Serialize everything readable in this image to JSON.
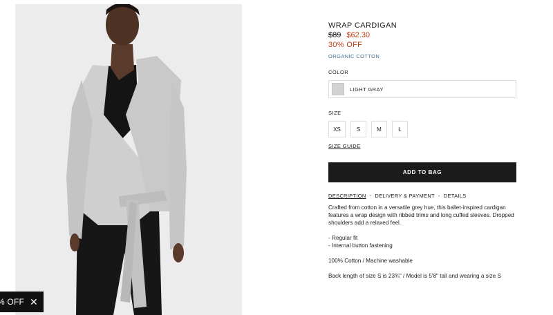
{
  "product": {
    "title": "WRAP CARDIGAN",
    "old_price": "$89",
    "new_price": "$62.30",
    "discount": "30% OFF",
    "material": "ORGANIC COTTON"
  },
  "color": {
    "label": "COLOR",
    "selected": "LIGHT GRAY",
    "swatch": "#d3d3d3"
  },
  "size": {
    "label": "SIZE",
    "options": [
      "XS",
      "S",
      "M",
      "L"
    ],
    "guide": "SIZE GUIDE"
  },
  "cart": {
    "add_label": "ADD TO BAG"
  },
  "tabs": {
    "items": [
      "DESCRIPTION",
      "DELIVERY & PAYMENT",
      "DETAILS"
    ],
    "separator": "-"
  },
  "description": {
    "paragraph": "Crafted from cotton in a versatile grey hue, this ballet-inspired cardigan features a wrap design with ribbed trims and long cuffed sleeves. Dropped shoulders add a relaxed feel.",
    "bullets": [
      "- Regular fit",
      "- Internal button fastening"
    ],
    "care": "100% Cotton / Machine washable",
    "measurements": "Back length of size S is 23¾\" / Model is 5'8\" tall and wearing a size S"
  },
  "promo": {
    "text": "% OFF",
    "close_icon": "close-icon"
  },
  "colors": {
    "accent_price": "#c23b12",
    "link_blue": "#3f6f8a",
    "button": "#1b1b1b"
  }
}
